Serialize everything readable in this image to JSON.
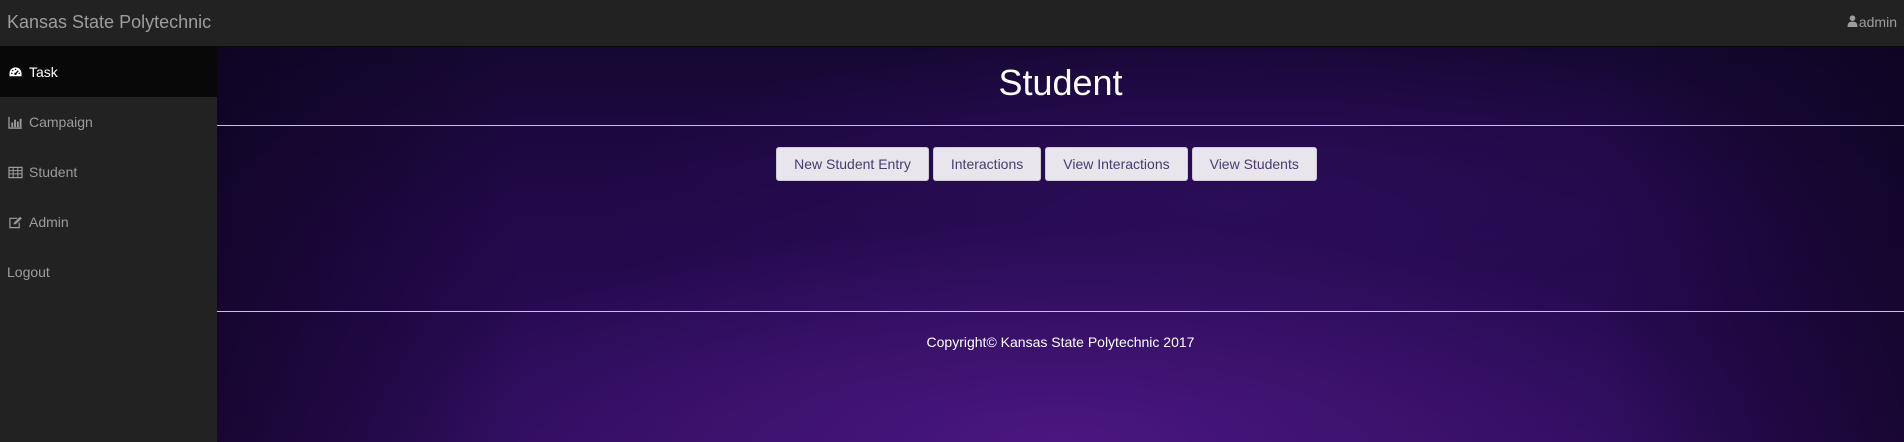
{
  "navbar": {
    "brand": "Kansas State Polytechnic",
    "user": "admin",
    "user_icon": "user-icon"
  },
  "sidebar": {
    "items": [
      {
        "label": "Task",
        "icon": "dashboard-icon",
        "active": true
      },
      {
        "label": "Campaign",
        "icon": "bar-chart-icon",
        "active": false
      },
      {
        "label": "Student",
        "icon": "table-icon",
        "active": false
      },
      {
        "label": "Admin",
        "icon": "edit-icon",
        "active": false
      },
      {
        "label": "Logout",
        "icon": "",
        "active": false
      }
    ]
  },
  "main": {
    "title": "Student",
    "buttons": [
      {
        "label": "New Student Entry"
      },
      {
        "label": "Interactions"
      },
      {
        "label": "View Interactions"
      },
      {
        "label": "View Students"
      }
    ],
    "footer": "Copyright© Kansas State Polytechnic 2017"
  },
  "colors": {
    "navbar_bg": "#222222",
    "sidebar_active_bg": "#080808",
    "nav_text": "#9d9d9d",
    "background_purple": "#2c0c5a",
    "button_bg": "#e8e6ec",
    "button_text": "#4a3a6e"
  }
}
